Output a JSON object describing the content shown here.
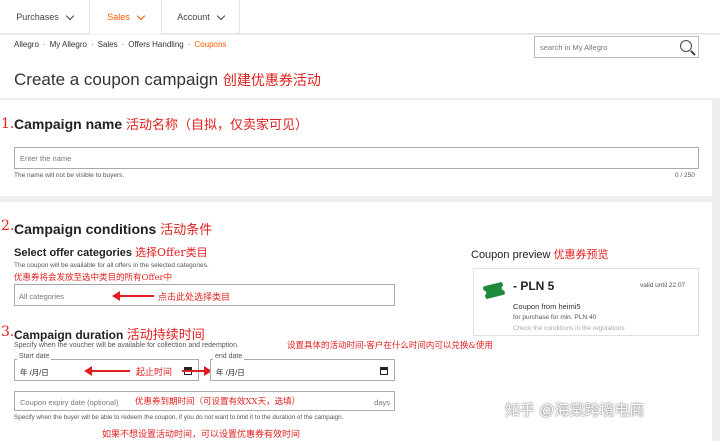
{
  "nav": {
    "tabs": [
      {
        "label": "Purchases"
      },
      {
        "label": "Sales"
      },
      {
        "label": "Account"
      }
    ]
  },
  "breadcrumb": [
    "Allegro",
    "My Allegro",
    "Sales",
    "Offers Handling",
    "Coupons"
  ],
  "search": {
    "placeholder": "search in My Allegro"
  },
  "page": {
    "title": "Create a coupon campaign",
    "title_note": "创建优惠券活动"
  },
  "campaign_name": {
    "number": "1.",
    "title": "Campaign name",
    "title_note": "活动名称（自拟，仅卖家可见）",
    "placeholder": "Enter the name",
    "helper": "The name will not be visible to buyers.",
    "counter": "0 / 250"
  },
  "conditions": {
    "number": "2.",
    "title": "Campaign conditions",
    "title_note": "活动条件",
    "categories": {
      "title": "Select offer categories",
      "title_note": "选择Offer类目",
      "desc": "The coupon will be available for all offers in the selected categories.",
      "desc_note": "优惠券将会发放至选中类目的所有Offer中",
      "placeholder": "All categories",
      "arrow_note": "点击此处选择类目"
    }
  },
  "duration": {
    "number": "3.",
    "title": "Campaign duration",
    "title_note": "活动持续时间",
    "desc": "Specify when the voucher will be available for collection and redemption.",
    "desc_note": "设置具体的活动时间-客户在什么时间内可以兑换&使用",
    "start_label": "Start date",
    "end_label": "end date",
    "date_value": "年 /月/日",
    "range_note": "起止时间",
    "expiry_placeholder": "Coupon expiry date (optional)",
    "expiry_note": "优惠券到期时间（可设置有效XX天，选填）",
    "expiry_unit": "days",
    "expiry_helper": "Specify when the buyer will be able to redeem the coupon, if you do not want to limit it to the duration of the campaign.",
    "bottom_note": "如果不想设置活动时间，可以设置优惠券有效时间"
  },
  "preview": {
    "title": "Coupon preview",
    "title_note": "优惠券预览",
    "amount": "- PLN 5",
    "valid": "valid until 22.07",
    "from": "Coupon from heimi5",
    "min": "for purchase for min. PLN 40",
    "check": "Check the conditions in the regulations"
  },
  "watermark": "知乎 @海棠跨境电商",
  "colors": {
    "accent": "#ff5a00",
    "annotation": "#e02020",
    "ticket": "#1f8a3b"
  }
}
